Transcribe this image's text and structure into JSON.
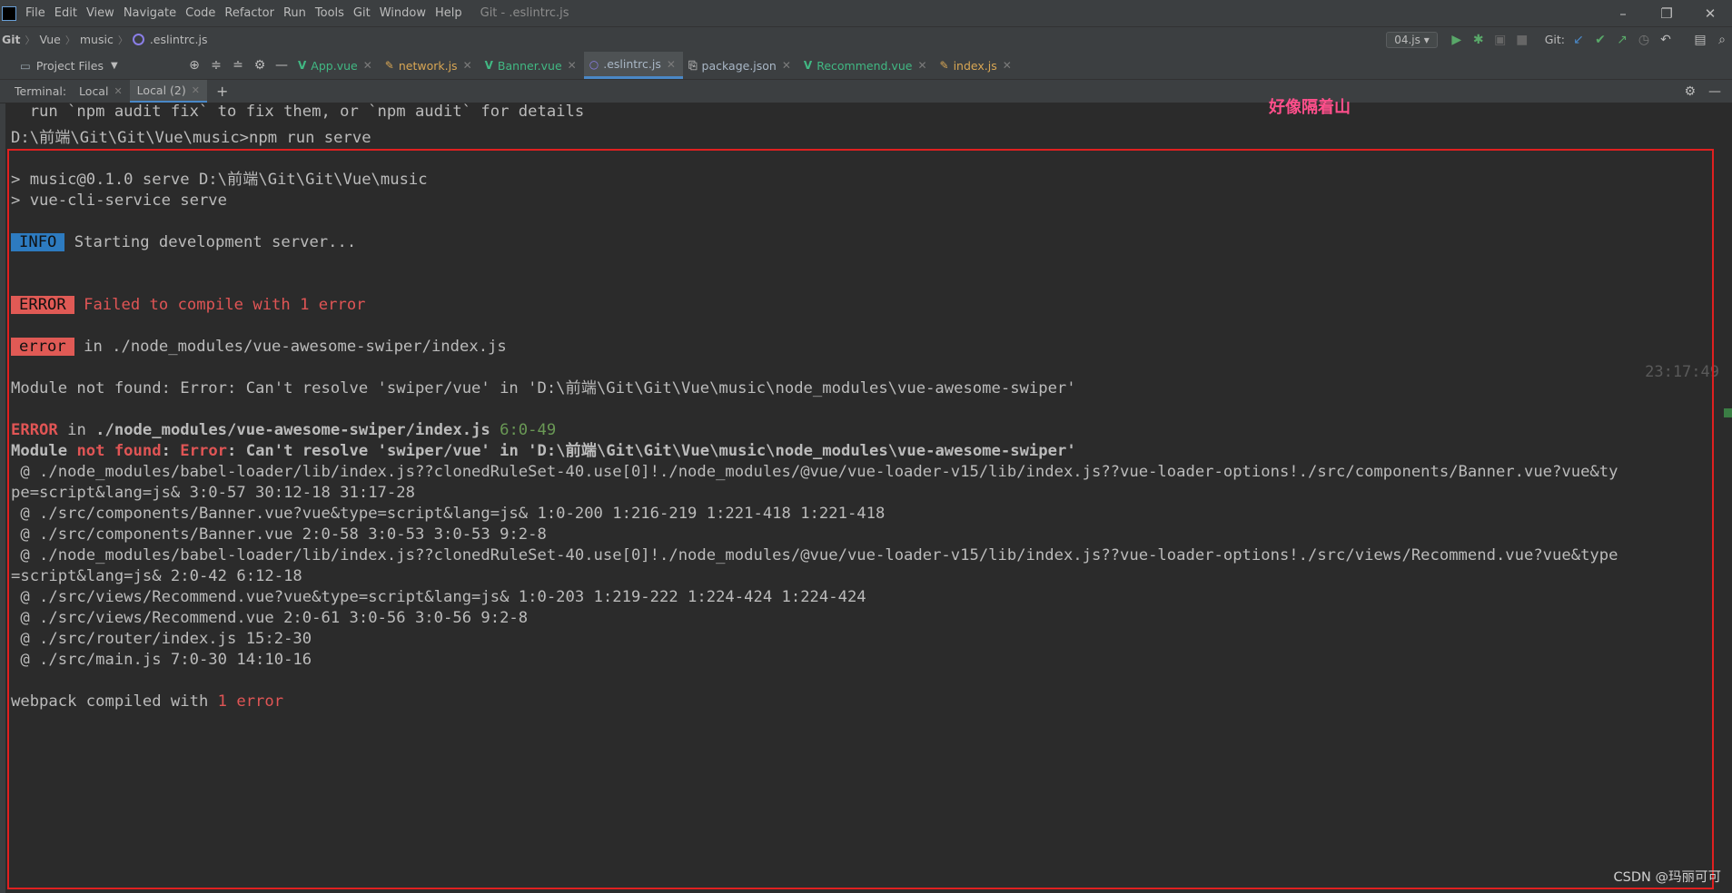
{
  "menu": {
    "items": [
      "File",
      "Edit",
      "View",
      "Navigate",
      "Code",
      "Refactor",
      "Run",
      "Tools",
      "Git",
      "Window",
      "Help"
    ],
    "title": "Git - .eslintrc.js"
  },
  "nav": {
    "crumbs": [
      "Git",
      "Vue",
      "music",
      ".eslintrc.js"
    ],
    "run_config": "04.js",
    "git_label": "Git:"
  },
  "tools": {
    "project_label": "Project Files"
  },
  "tabs": [
    {
      "label": "App.vue",
      "kind": "vue",
      "active": false
    },
    {
      "label": "network.js",
      "kind": "js",
      "active": false
    },
    {
      "label": "Banner.vue",
      "kind": "vue",
      "active": false
    },
    {
      "label": ".eslintrc.js",
      "kind": "eslint",
      "active": true
    },
    {
      "label": "package.json",
      "kind": "pkg",
      "active": false
    },
    {
      "label": "Recommend.vue",
      "kind": "vue",
      "active": false
    },
    {
      "label": "index.js",
      "kind": "js",
      "active": false
    }
  ],
  "terminal": {
    "label": "Terminal:",
    "tabs": [
      {
        "label": "Local",
        "active": false
      },
      {
        "label": "Local (2)",
        "active": true
      }
    ]
  },
  "annotation": "好像隔着山",
  "timestamp": "23:17:49",
  "watermark": "CSDN @玛丽可可",
  "lines": {
    "l0": "  run `npm audit fix` to fix them, or `npm audit` for details",
    "l1": "D:\\前端\\Git\\Git\\Vue\\music>npm run serve",
    "l2": "> music@0.1.0 serve D:\\前端\\Git\\Git\\Vue\\music",
    "l3": "> vue-cli-service serve",
    "info_badge": "INFO",
    "l4": " Starting development server...",
    "error_badge": "ERROR",
    "l5": " Failed to compile with 1 error",
    "error_badge2": "error",
    "l6": " in ./node_modules/vue-awesome-swiper/index.js",
    "l7": "Module not found: Error: Can't resolve 'swiper/vue' in 'D:\\前端\\Git\\Git\\Vue\\music\\node_modules\\vue-awesome-swiper'",
    "l8a": "ERROR",
    "l8b": " in ",
    "l8c": "./node_modules/vue-awesome-swiper/index.js",
    "l8d": " 6:0-49",
    "l9a": "Module ",
    "l9b": "not found",
    "l9c": ": ",
    "l9d": "Error",
    "l9e": ": Can't resolve 'swiper/vue' in 'D:\\前端\\Git\\Git\\Vue\\music\\node_modules\\vue-awesome-swiper'",
    "l10": " @ ./node_modules/babel-loader/lib/index.js??clonedRuleSet-40.use[0]!./node_modules/@vue/vue-loader-v15/lib/index.js??vue-loader-options!./src/components/Banner.vue?vue&ty",
    "l11": "pe=script&lang=js& 3:0-57 30:12-18 31:17-28",
    "l12": " @ ./src/components/Banner.vue?vue&type=script&lang=js& 1:0-200 1:216-219 1:221-418 1:221-418",
    "l13": " @ ./src/components/Banner.vue 2:0-58 3:0-53 3:0-53 9:2-8",
    "l14": " @ ./node_modules/babel-loader/lib/index.js??clonedRuleSet-40.use[0]!./node_modules/@vue/vue-loader-v15/lib/index.js??vue-loader-options!./src/views/Recommend.vue?vue&type",
    "l15": "=script&lang=js& 2:0-42 6:12-18",
    "l16": " @ ./src/views/Recommend.vue?vue&type=script&lang=js& 1:0-203 1:219-222 1:224-424 1:224-424",
    "l17": " @ ./src/views/Recommend.vue 2:0-61 3:0-56 3:0-56 9:2-8",
    "l18": " @ ./src/router/index.js 15:2-30",
    "l19": " @ ./src/main.js 7:0-30 14:10-16",
    "l20a": "webpack compiled with ",
    "l20b": "1 error"
  }
}
